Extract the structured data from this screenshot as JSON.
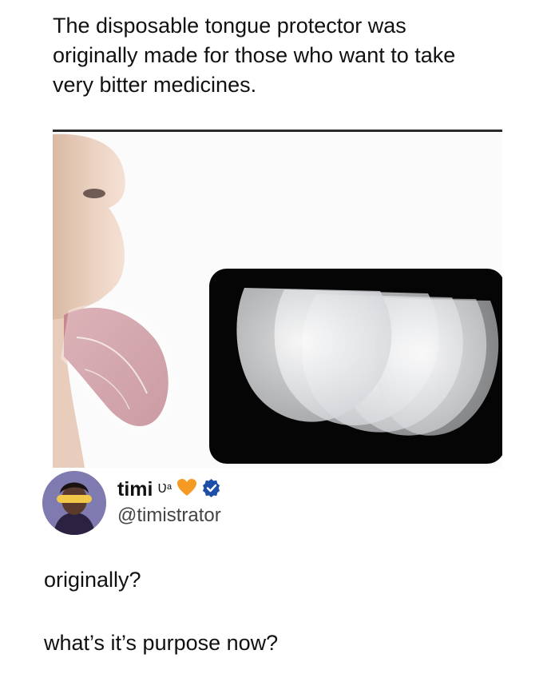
{
  "caption": {
    "lines": [
      "The disposable tongue protector was",
      "originally made for those who want to take",
      "very bitter medicines."
    ]
  },
  "media": {
    "description_icon": "tongue-protector-photo"
  },
  "author": {
    "display_name": "timi",
    "name_suffix": "Ʋᵃ",
    "heart_color": "#f59a23",
    "verified_color": "#1d4fa8",
    "handle": "@timistrator"
  },
  "replies": [
    "originally?",
    "what’s it’s purpose now?"
  ]
}
